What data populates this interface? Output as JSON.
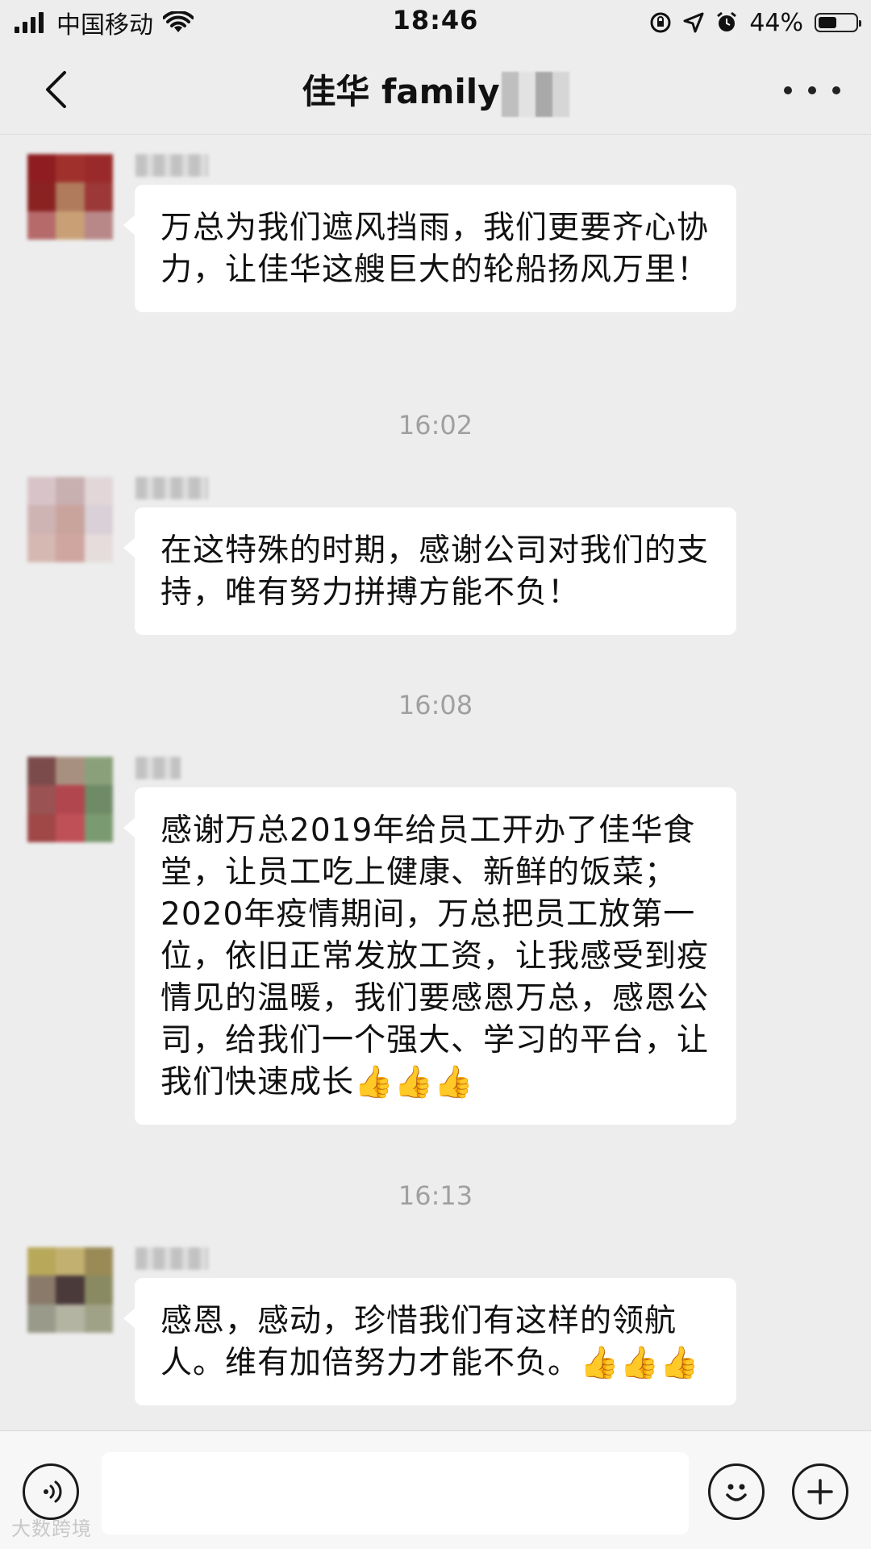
{
  "status_bar": {
    "carrier": "中国移动",
    "time": "18:46",
    "battery": "44%",
    "battery_level": 0.44
  },
  "nav": {
    "title": "佳华 family"
  },
  "messages": [
    {
      "text": "万总为我们遮风挡雨，我们更要齐心协力，让佳华这艘巨大的轮船扬风万里！"
    },
    {
      "timestamp": "16:02",
      "text": "在这特殊的时期，感谢公司对我们的支持，唯有努力拼搏方能不负！"
    },
    {
      "timestamp": "16:08",
      "text": "感谢万总2019年给员工开办了佳华食堂，让员工吃上健康、新鲜的饭菜；2020年疫情期间，万总把员工放第一位，依旧正常发放工资，让我感受到疫情见的温暖，我们要感恩万总，感恩公司，给我们一个强大、学习的平台，让我们快速成长👍👍👍"
    },
    {
      "timestamp": "16:13",
      "text": "感恩，感动，珍惜我们有这样的领航人。维有加倍努力才能不负。👍👍👍"
    }
  ],
  "input_bar": {
    "voice_icon": "voice-icon",
    "emoji_icon": "emoji-icon",
    "plus_icon": "plus-icon"
  },
  "watermark": "大数跨境"
}
